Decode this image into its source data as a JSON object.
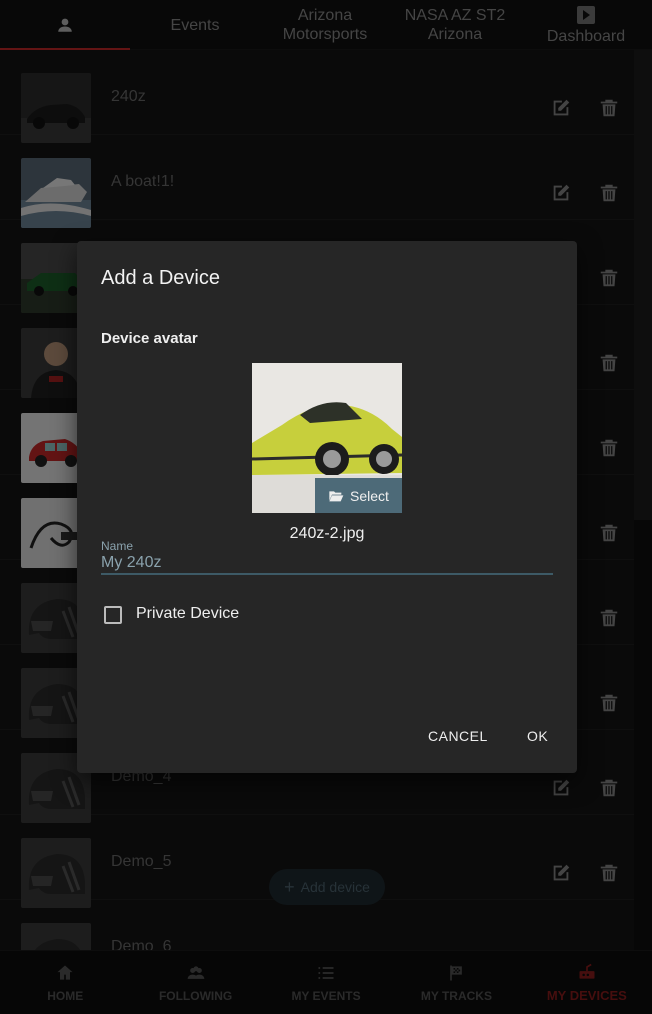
{
  "top_tabs": [
    {
      "label": "",
      "icon": "person-icon"
    },
    {
      "label": "Events"
    },
    {
      "label": "Arizona\nMotorsports"
    },
    {
      "label": "NASA AZ ST2\nArizona"
    },
    {
      "label": "Dashboard",
      "icon": "play-icon"
    }
  ],
  "devices": [
    {
      "name": "240z",
      "thumb": "car-dark"
    },
    {
      "name": "A boat!1!",
      "thumb": "boat"
    },
    {
      "name": "",
      "thumb": "race-car"
    },
    {
      "name": "",
      "thumb": "person"
    },
    {
      "name": "",
      "thumb": "red-car"
    },
    {
      "name": "",
      "thumb": "cable"
    },
    {
      "name": "",
      "thumb": "helmet"
    },
    {
      "name": "",
      "thumb": "helmet"
    },
    {
      "name": "Demo_4",
      "thumb": "helmet"
    },
    {
      "name": "Demo_5",
      "thumb": "helmet"
    },
    {
      "name": "Demo_6",
      "thumb": "helmet"
    }
  ],
  "add_device_label": "Add device",
  "bottom_nav": [
    {
      "label": "HOME",
      "icon": "home-icon"
    },
    {
      "label": "FOLLOWING",
      "icon": "group-icon"
    },
    {
      "label": "MY EVENTS",
      "icon": "list-icon"
    },
    {
      "label": "MY TRACKS",
      "icon": "flag-icon"
    },
    {
      "label": "MY DEVICES",
      "icon": "device-icon",
      "active": true
    }
  ],
  "dialog": {
    "title": "Add a Device",
    "avatar_label": "Device avatar",
    "select_label": "Select",
    "filename": "240z-2.jpg",
    "name_label": "Name",
    "name_value": "My 240z",
    "private_label": "Private Device",
    "private_checked": false,
    "cancel_label": "CANCEL",
    "ok_label": "OK"
  },
  "colors": {
    "accent_red": "#c62828",
    "select_button": "#4d6a78",
    "dialog_bg": "#262626"
  }
}
